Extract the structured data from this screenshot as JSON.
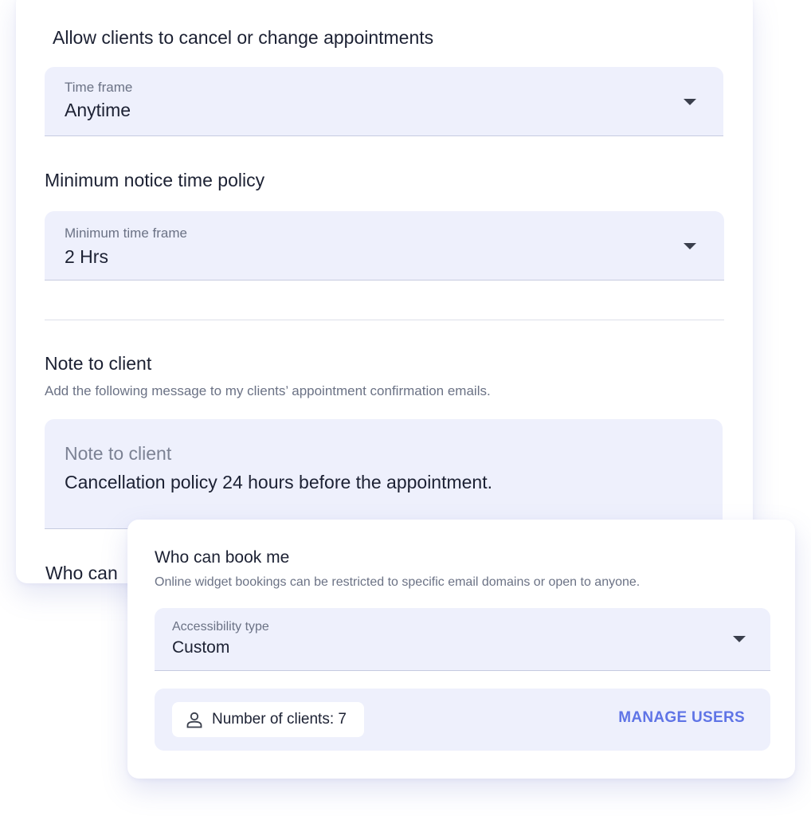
{
  "cancellation": {
    "heading": "Allow clients to cancel or change appointments",
    "time_frame": {
      "label": "Time frame",
      "value": "Anytime"
    }
  },
  "notice_policy": {
    "heading": "Minimum notice time policy",
    "min_time_frame": {
      "label": "Minimum time frame",
      "value": "2 Hrs"
    }
  },
  "note": {
    "heading": "Note to client",
    "description": "Add the following message to my clients’ appointment confirmation emails.",
    "field": {
      "label": "Note to client",
      "value": "Cancellation policy 24 hours before the appointment."
    }
  },
  "who_can_book_back": {
    "heading_partial": "Who can"
  },
  "who_can_book": {
    "heading": "Who can book me",
    "description": "Online widget bookings can be restricted to specific email domains or open to anyone.",
    "accessibility": {
      "label": "Accessibility type",
      "value": "Custom"
    },
    "clients_count_text": "Number of clients: 7",
    "manage_button": "MANAGE USERS"
  },
  "icons": {
    "dropdown": "chevron-down-icon",
    "user": "user-icon"
  },
  "colors": {
    "field_bg": "#eef0fc",
    "accent": "#5f74e6",
    "text": "#1c2133",
    "muted": "#6b7285"
  }
}
